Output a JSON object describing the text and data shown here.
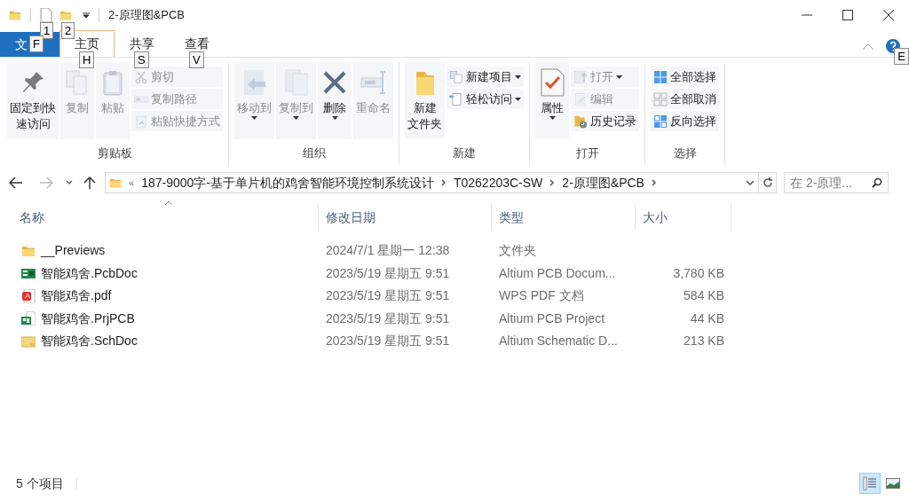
{
  "window": {
    "title": "2-原理图&PCB"
  },
  "quick_access": [
    {
      "keytip": "1"
    },
    {
      "keytip": "2"
    }
  ],
  "tabs": [
    {
      "label": "文",
      "kind": "file",
      "keytip": "F",
      "selected": false
    },
    {
      "label": "主页",
      "kind": "tab",
      "keytip": "H",
      "selected": true
    },
    {
      "label": "共享",
      "kind": "tab",
      "keytip": "S",
      "selected": false
    },
    {
      "label": "查看",
      "kind": "tab",
      "keytip": "V",
      "selected": false
    }
  ],
  "help": {
    "keytip": "E"
  },
  "ribbon": [
    {
      "label": "剪贴板",
      "items": [
        {
          "kind": "large",
          "lines": [
            "固定到快",
            "速访问"
          ],
          "disabled": false,
          "caret": false
        },
        {
          "kind": "large",
          "label": "复制",
          "disabled": true,
          "caret": false
        },
        {
          "kind": "large",
          "label": "粘贴",
          "disabled": true,
          "caret": false
        },
        {
          "kind": "small",
          "label": "剪切",
          "disabled": true,
          "caret": false
        },
        {
          "kind": "small",
          "label": "复制路径",
          "disabled": true,
          "caret": false
        },
        {
          "kind": "small",
          "label": "粘贴快捷方式",
          "disabled": true,
          "caret": false
        }
      ]
    },
    {
      "label": "组织",
      "items": [
        {
          "kind": "large",
          "label": "移动到",
          "disabled": true,
          "caret": true
        },
        {
          "kind": "large",
          "label": "复制到",
          "disabled": true,
          "caret": true
        },
        {
          "kind": "large",
          "label": "删除",
          "disabled": false,
          "caret": true
        },
        {
          "kind": "large",
          "label": "重命名",
          "disabled": true,
          "caret": false
        }
      ]
    },
    {
      "label": "新建",
      "items": [
        {
          "kind": "large",
          "lines": [
            "新建",
            "文件夹"
          ],
          "disabled": false,
          "caret": false
        },
        {
          "kind": "small",
          "label": "新建项目",
          "disabled": false,
          "caret": true
        },
        {
          "kind": "small",
          "label": "轻松访问",
          "disabled": false,
          "caret": true
        }
      ]
    },
    {
      "label": "打开",
      "items": [
        {
          "kind": "large",
          "label": "属性",
          "disabled": false,
          "caret": true
        },
        {
          "kind": "small",
          "label": "打开",
          "disabled": true,
          "caret": true
        },
        {
          "kind": "small",
          "label": "编辑",
          "disabled": true,
          "caret": false
        },
        {
          "kind": "small",
          "label": "历史记录",
          "disabled": false,
          "caret": false
        }
      ]
    },
    {
      "label": "选择",
      "items": [
        {
          "kind": "small",
          "label": "全部选择",
          "disabled": false,
          "caret": false
        },
        {
          "kind": "small",
          "label": "全部取消",
          "disabled": false,
          "caret": false
        },
        {
          "kind": "small",
          "label": "反向选择",
          "disabled": false,
          "caret": false
        }
      ]
    }
  ],
  "address": {
    "overflow": "«",
    "segments": [
      "187-9000字-基于单片机的鸡舍智能环境控制系统设计",
      "T0262203C-SW",
      "2-原理图&PCB"
    ]
  },
  "search": {
    "placeholder": "在 2-原理..."
  },
  "table": {
    "columns": [
      "名称",
      "修改日期",
      "类型",
      "大小"
    ],
    "rows": [
      {
        "kind": "folder",
        "name": "__Previews",
        "date": "2024/7/1 星期一 12:38",
        "type": "文件夹",
        "size": ""
      },
      {
        "kind": "pcbdoc",
        "name": "智能鸡舍.PcbDoc",
        "date": "2023/5/19 星期五 9:51",
        "type": "Altium PCB Docum...",
        "size": "3,780 KB"
      },
      {
        "kind": "pdf",
        "name": "智能鸡舍.pdf",
        "date": "2023/5/19 星期五 9:51",
        "type": "WPS PDF 文档",
        "size": "584 KB"
      },
      {
        "kind": "prjpcb",
        "name": "智能鸡舍.PrjPCB",
        "date": "2023/5/19 星期五 9:51",
        "type": "Altium PCB Project",
        "size": "44 KB"
      },
      {
        "kind": "schdoc",
        "name": "智能鸡舍.SchDoc",
        "date": "2023/5/19 星期五 9:51",
        "type": "Altium Schematic D...",
        "size": "213 KB"
      }
    ]
  },
  "status_bar": {
    "count": "5 个项目",
    "views": [
      {
        "kind": "details",
        "selected": true
      },
      {
        "kind": "large",
        "selected": false
      }
    ]
  }
}
